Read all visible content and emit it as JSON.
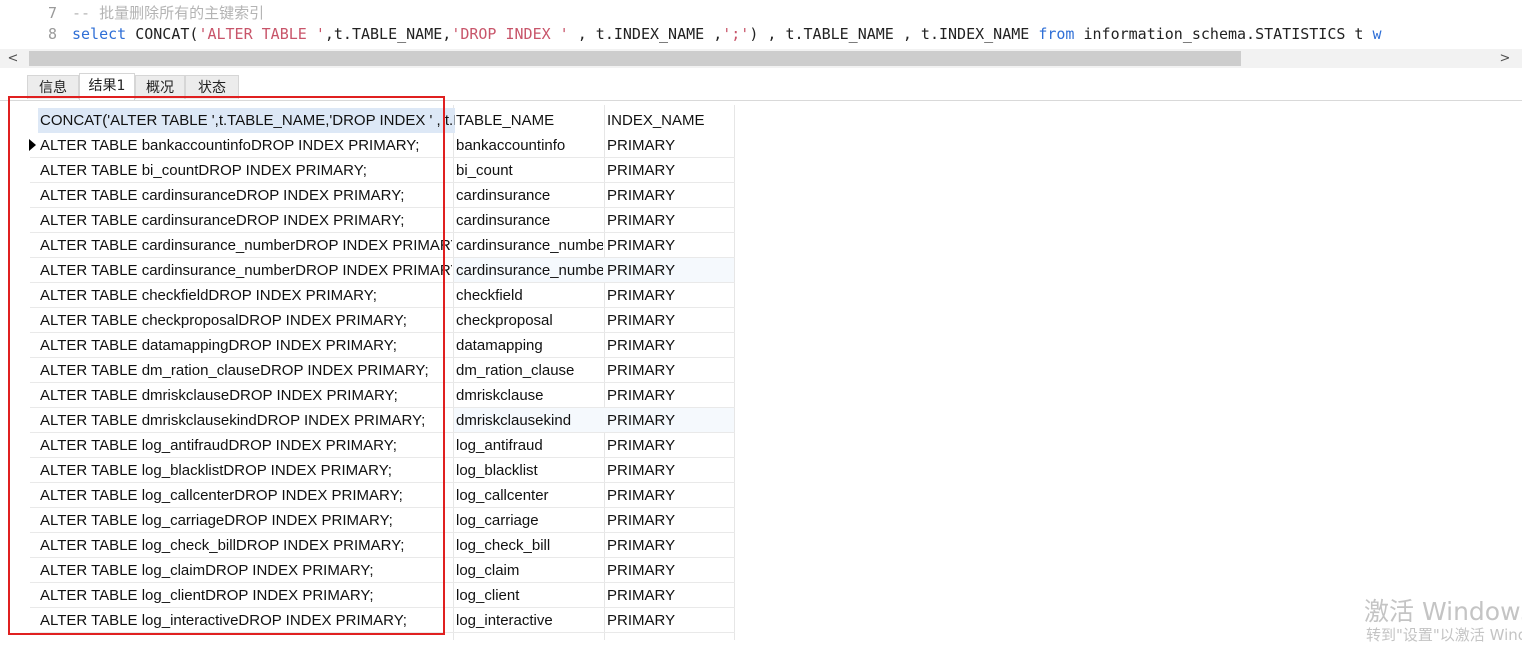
{
  "editor": {
    "lines": [
      {
        "number": "7",
        "comment": "-- 批量删除所有的主键索引"
      },
      {
        "number": "8",
        "segments": [
          {
            "text": "select",
            "kind": "kw"
          },
          {
            "text": " CONCAT(",
            "kind": "tx"
          },
          {
            "text": "'ALTER TABLE '",
            "kind": "st"
          },
          {
            "text": ",t.TABLE_NAME,",
            "kind": "tx"
          },
          {
            "text": "'DROP INDEX '",
            "kind": "st"
          },
          {
            "text": " , t.INDEX_NAME ,",
            "kind": "tx"
          },
          {
            "text": "';'",
            "kind": "st"
          },
          {
            "text": ") , t.TABLE_NAME , t.INDEX_NAME ",
            "kind": "tx"
          },
          {
            "text": "from",
            "kind": "kw"
          },
          {
            "text": " information_schema.STATISTICS t ",
            "kind": "tx"
          },
          {
            "text": "w",
            "kind": "kw"
          }
        ]
      }
    ]
  },
  "scrollbar": {
    "left_arrow": "<",
    "right_arrow": ">"
  },
  "tabs": [
    {
      "label": "信息",
      "active": false
    },
    {
      "label": "结果1",
      "active": true
    },
    {
      "label": "概况",
      "active": false
    },
    {
      "label": "状态",
      "active": false
    }
  ],
  "grid": {
    "columns": [
      "CONCAT('ALTER TABLE ',t.TABLE_NAME,'DROP INDEX ' , t.INDEX_NAME ,';')",
      "TABLE_NAME",
      "INDEX_NAME"
    ],
    "rows": [
      [
        "ALTER TABLE bankaccountinfoDROP INDEX PRIMARY;",
        "bankaccountinfo",
        "PRIMARY"
      ],
      [
        "ALTER TABLE bi_countDROP INDEX PRIMARY;",
        "bi_count",
        "PRIMARY"
      ],
      [
        "ALTER TABLE cardinsuranceDROP INDEX PRIMARY;",
        "cardinsurance",
        "PRIMARY"
      ],
      [
        "ALTER TABLE cardinsuranceDROP INDEX PRIMARY;",
        "cardinsurance",
        "PRIMARY"
      ],
      [
        "ALTER TABLE cardinsurance_numberDROP INDEX PRIMARY;",
        "cardinsurance_number",
        "PRIMARY"
      ],
      [
        "ALTER TABLE cardinsurance_numberDROP INDEX PRIMARY;",
        "cardinsurance_number",
        "PRIMARY"
      ],
      [
        "ALTER TABLE checkfieldDROP INDEX PRIMARY;",
        "checkfield",
        "PRIMARY"
      ],
      [
        "ALTER TABLE checkproposalDROP INDEX PRIMARY;",
        "checkproposal",
        "PRIMARY"
      ],
      [
        "ALTER TABLE datamappingDROP INDEX PRIMARY;",
        "datamapping",
        "PRIMARY"
      ],
      [
        "ALTER TABLE dm_ration_clauseDROP INDEX PRIMARY;",
        "dm_ration_clause",
        "PRIMARY"
      ],
      [
        "ALTER TABLE dmriskclauseDROP INDEX PRIMARY;",
        "dmriskclause",
        "PRIMARY"
      ],
      [
        "ALTER TABLE dmriskclausekindDROP INDEX PRIMARY;",
        "dmriskclausekind",
        "PRIMARY"
      ],
      [
        "ALTER TABLE log_antifraudDROP INDEX PRIMARY;",
        "log_antifraud",
        "PRIMARY"
      ],
      [
        "ALTER TABLE log_blacklistDROP INDEX PRIMARY;",
        "log_blacklist",
        "PRIMARY"
      ],
      [
        "ALTER TABLE log_callcenterDROP INDEX PRIMARY;",
        "log_callcenter",
        "PRIMARY"
      ],
      [
        "ALTER TABLE log_carriageDROP INDEX PRIMARY;",
        "log_carriage",
        "PRIMARY"
      ],
      [
        "ALTER TABLE log_check_billDROP INDEX PRIMARY;",
        "log_check_bill",
        "PRIMARY"
      ],
      [
        "ALTER TABLE log_claimDROP INDEX PRIMARY;",
        "log_claim",
        "PRIMARY"
      ],
      [
        "ALTER TABLE log_clientDROP INDEX PRIMARY;",
        "log_client",
        "PRIMARY"
      ],
      [
        "ALTER TABLE log_interactiveDROP INDEX PRIMARY;",
        "log_interactive",
        "PRIMARY"
      ]
    ]
  },
  "watermark": {
    "title": "激活 Windows",
    "subtitle": "转到\"设置\"以激活 Windows。"
  },
  "colors": {
    "selection_header": "#dde8f6",
    "alt_row": "#f5f9fd",
    "highlight_box": "#e02020",
    "keyword": "#2f6fd6",
    "string": "#c8556a"
  }
}
